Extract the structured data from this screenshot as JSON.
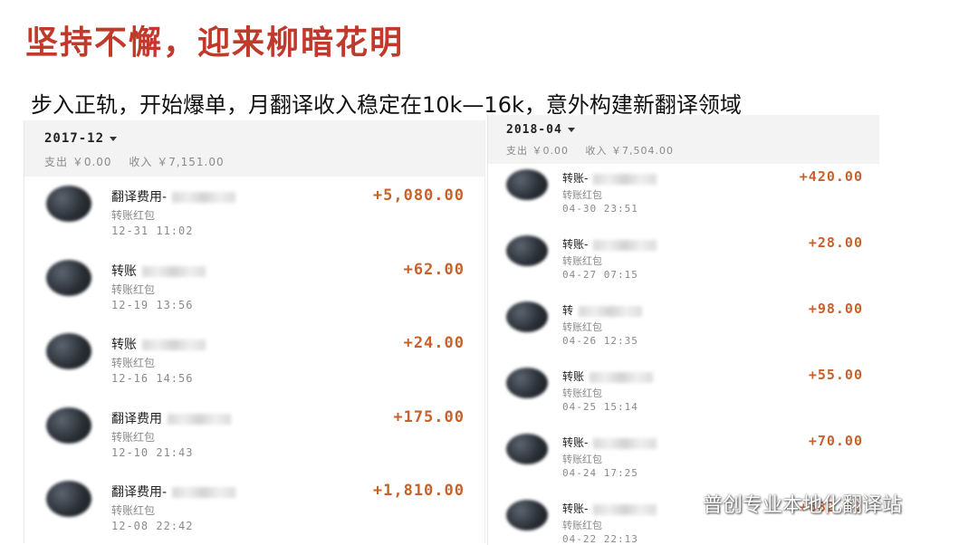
{
  "title": "坚持不懈，迎来柳暗花明",
  "subtitle": "步入正轨，开始爆单，月翻译收入稳定在10k—16k，意外构建新翻译领域",
  "left_panel": {
    "month": "2017-12",
    "summary": {
      "expense": "支出 ￥0.00",
      "income": "收入 ￥7,151.00"
    },
    "items": [
      {
        "name": "翻译费用-",
        "sub": "转账红包",
        "time": "12-31  11:02",
        "amount": "+5,080.00"
      },
      {
        "name": "转账",
        "sub": "转账红包",
        "time": "12-19  13:56",
        "amount": "+62.00"
      },
      {
        "name": "转账",
        "sub": "转账红包",
        "time": "12-16  14:56",
        "amount": "+24.00"
      },
      {
        "name": "翻译费用",
        "sub": "转账红包",
        "time": "12-10  21:43",
        "amount": "+175.00"
      },
      {
        "name": "翻译费用-",
        "sub": "转账红包",
        "time": "12-08  22:42",
        "amount": "+1,810.00"
      }
    ]
  },
  "right_panel": {
    "month": "2018-04",
    "summary": {
      "expense": "支出 ￥0.00",
      "income": "收入 ￥7,504.00"
    },
    "items": [
      {
        "name": "转账-",
        "sub": "转账红包",
        "time": "04-30  23:51",
        "amount": "+420.00"
      },
      {
        "name": "转账-",
        "sub": "转账红包",
        "time": "04-27  07:15",
        "amount": "+28.00"
      },
      {
        "name": "转",
        "sub": "转账红包",
        "time": "04-26  12:35",
        "amount": "+98.00"
      },
      {
        "name": "转账",
        "sub": "转账红包",
        "time": "04-25  15:14",
        "amount": "+55.00"
      },
      {
        "name": "转账-",
        "sub": "转账红包",
        "time": "04-24  17:25",
        "amount": "+70.00"
      },
      {
        "name": "转账-",
        "sub": "转账红包",
        "time": "04-22  22:13",
        "amount": "+682.00"
      }
    ]
  },
  "watermark": {
    "text": "普创专业本地化翻译站",
    "icon": "wechat-icon"
  },
  "colors": {
    "title": "#c0392b",
    "amount": "#c8612a",
    "header_bg": "#f3f3f3"
  }
}
